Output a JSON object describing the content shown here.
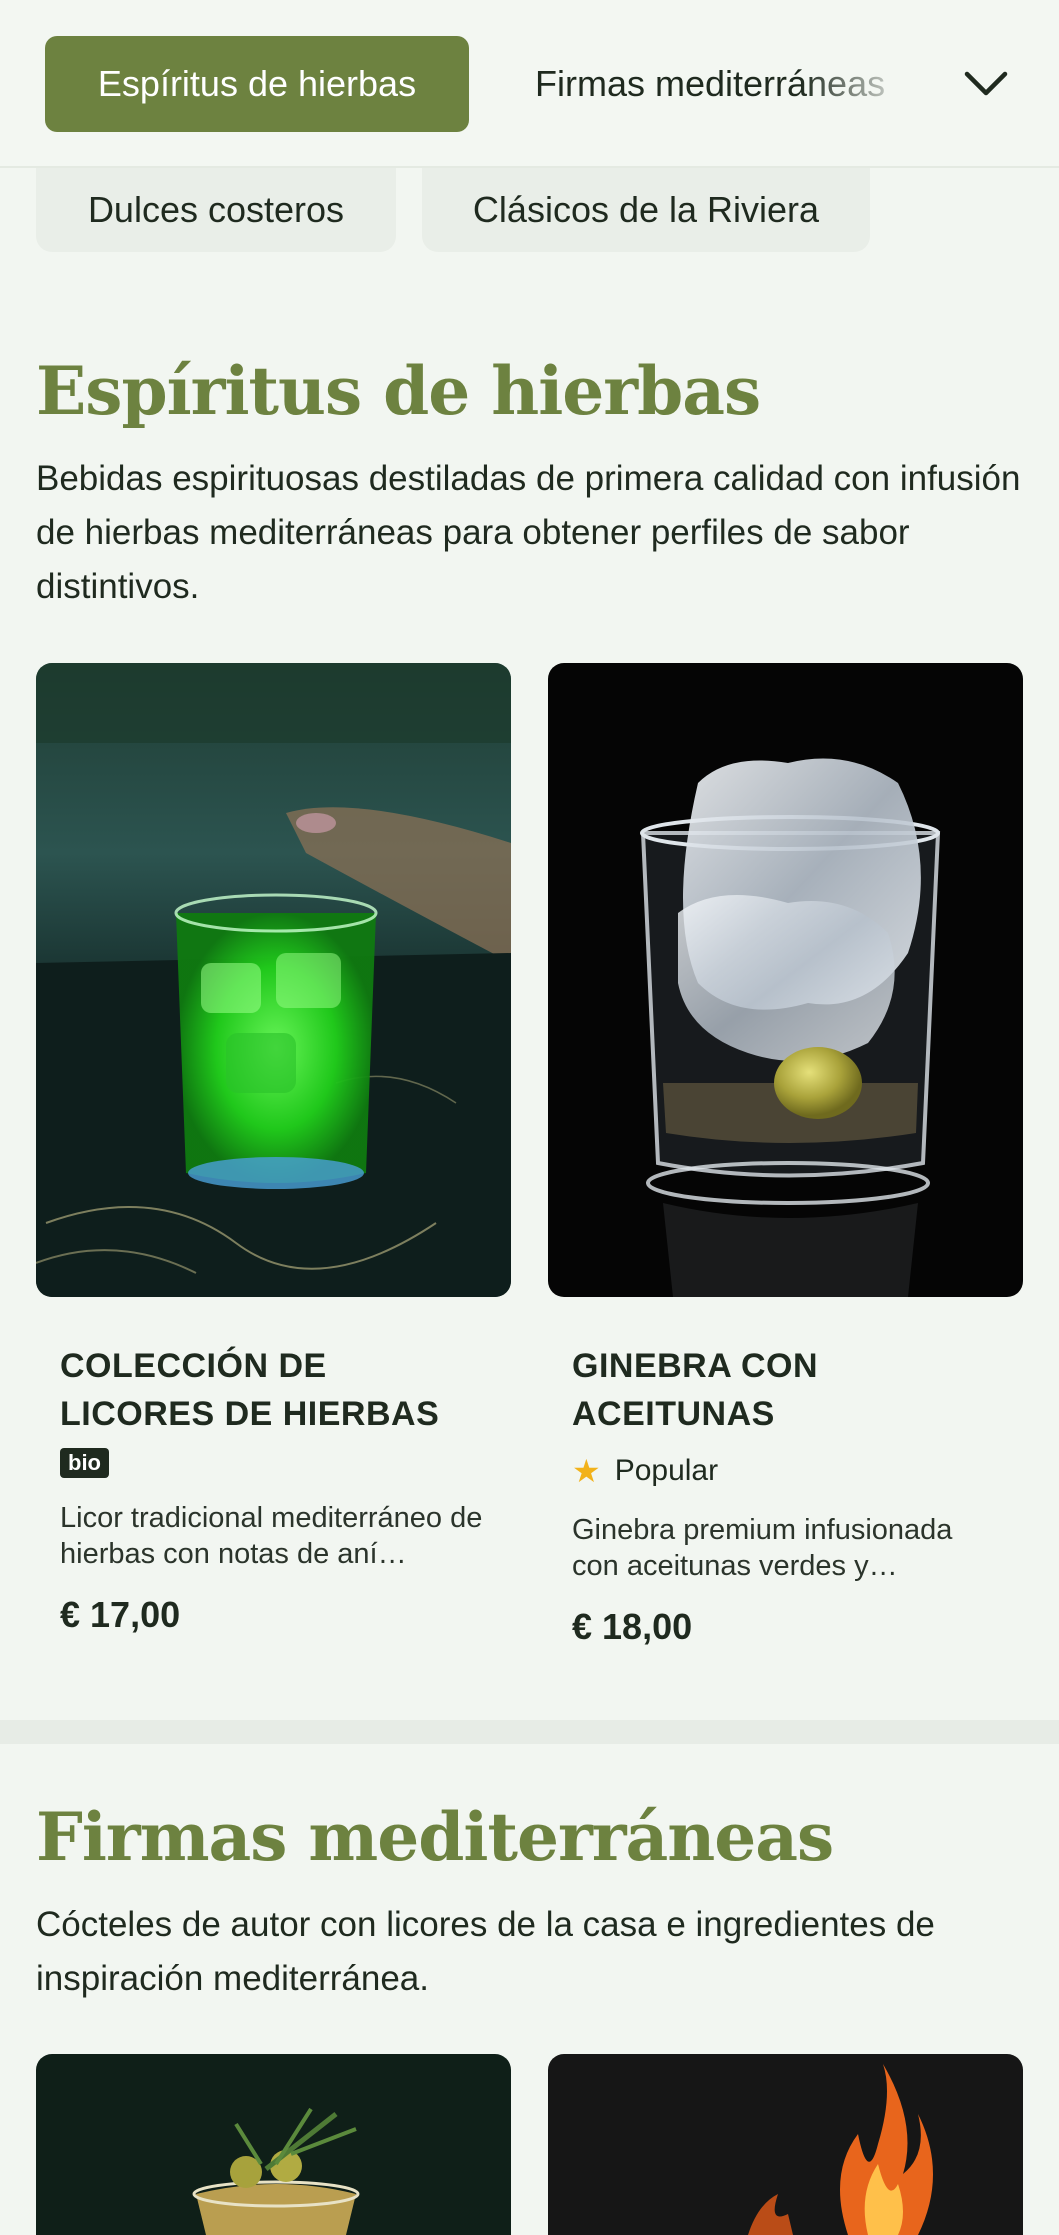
{
  "nav": {
    "active_tab": "Espíritus de hierbas",
    "next_tab": "Firmas mediterráneas",
    "chips": [
      "Dulces costeros",
      "Clásicos de la Riviera"
    ]
  },
  "sections": [
    {
      "title": "Espíritus de hierbas",
      "description": "Bebidas espirituosas destiladas de primera calidad con infusión de hierbas mediterráneas para obtener perfiles de sabor distintivos.",
      "products": [
        {
          "name": "COLECCIÓN DE LICORES DE HIERBAS",
          "badge": "bio",
          "description": "Licor tradicional mediterráneo de hierbas con notas de aní…",
          "price": "€ 17,00",
          "image_icon": "green-liqueur-glass-image"
        },
        {
          "name": "GINEBRA CON ACEITUNAS",
          "badge": "Popular",
          "description": "Ginebra premium infusionada con aceitunas verdes y…",
          "price": "€ 18,00",
          "image_icon": "gin-olive-glass-image"
        }
      ]
    },
    {
      "title": "Firmas mediterráneas",
      "description": "Cócteles de autor con licores de la casa e ingredientes de inspiración mediterránea."
    }
  ],
  "colors": {
    "accent": "#6d8240",
    "background": "#f2f6f1",
    "text": "#1f2a1f",
    "star": "#f2b21a"
  }
}
